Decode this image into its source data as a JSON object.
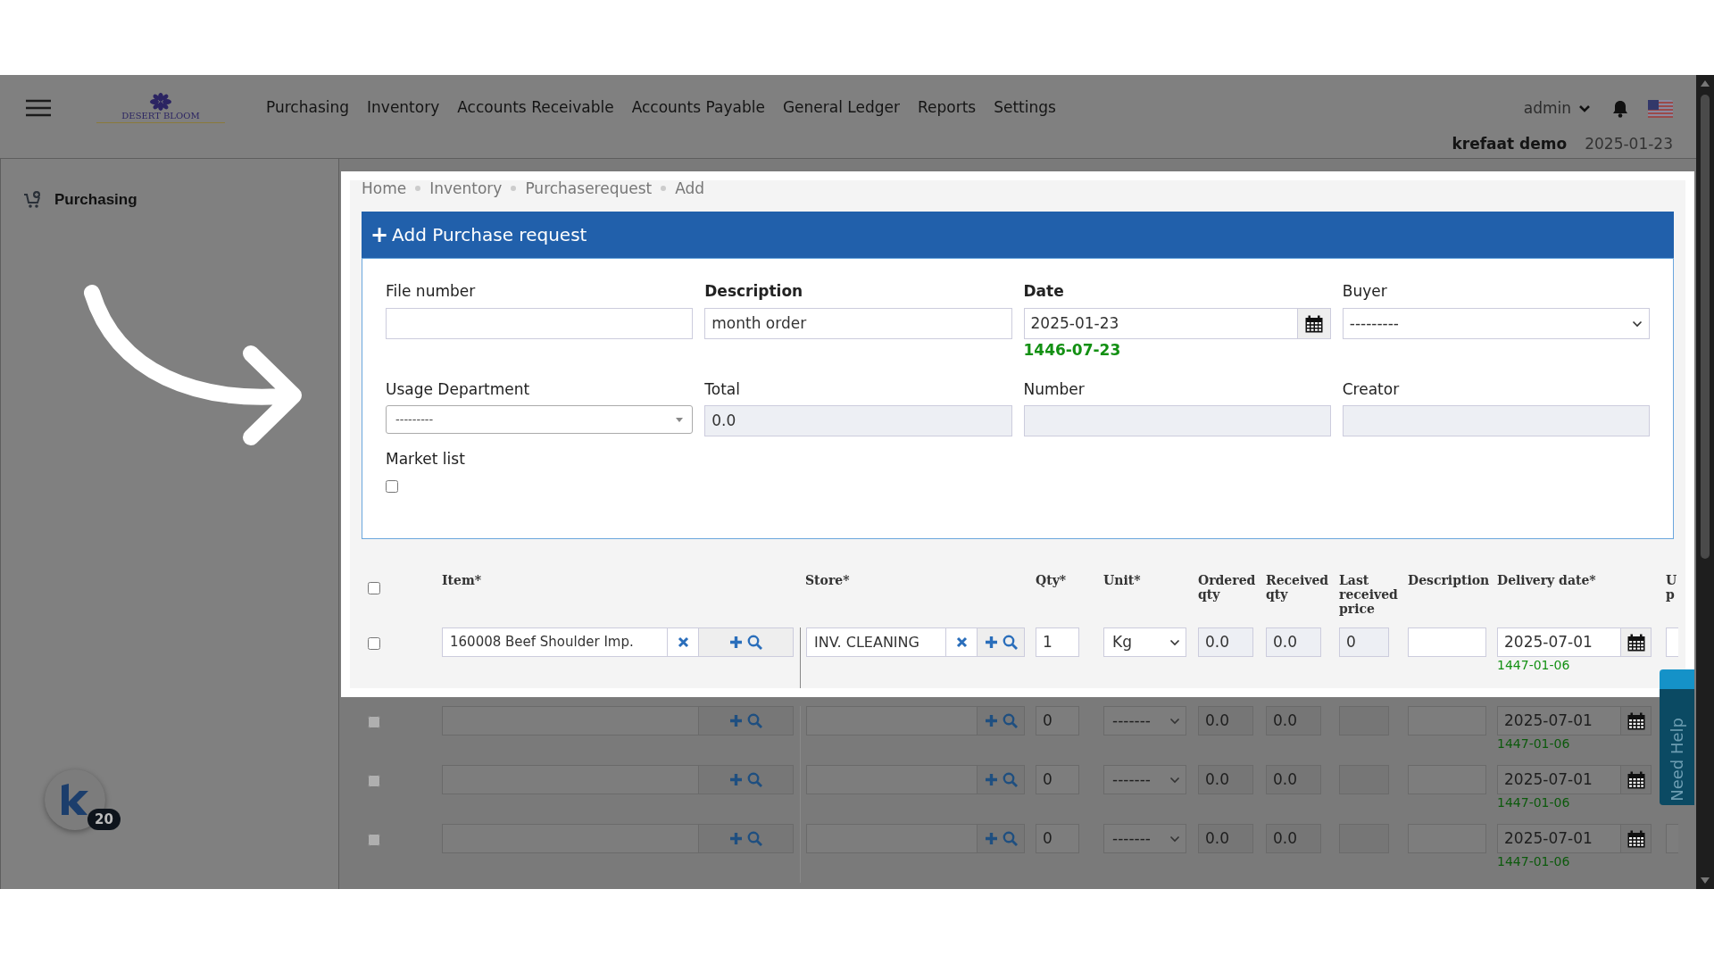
{
  "header": {
    "logo_text": "DESERT BLOOM",
    "nav": [
      "Purchasing",
      "Inventory",
      "Accounts Receivable",
      "Accounts Payable",
      "General Ledger",
      "Reports",
      "Settings"
    ],
    "user": "admin",
    "company": "krefaat demo",
    "date": "2025-01-23"
  },
  "sidebar": {
    "items": [
      {
        "label": "Purchasing"
      }
    ],
    "badge_count": "20"
  },
  "breadcrumb": [
    "Home",
    "Inventory",
    "Purchaserequest",
    "Add"
  ],
  "form": {
    "title": "Add Purchase request",
    "plus": "+",
    "fields": [
      {
        "label": "File number",
        "kind": "text",
        "required": false
      },
      {
        "label": "Description",
        "kind": "text",
        "required": true,
        "value": "month order"
      },
      {
        "label": "Date",
        "kind": "date",
        "required": true,
        "value": "2025-01-23",
        "hijri": "1446-07-23"
      },
      {
        "label": "Buyer",
        "kind": "select",
        "required": false,
        "value": "---------"
      },
      {
        "label": "Usage Department",
        "kind": "select2",
        "required": false,
        "value": "---------"
      },
      {
        "label": "Total",
        "kind": "readonly",
        "required": false,
        "value": "0.0"
      },
      {
        "label": "Number",
        "kind": "readonly",
        "required": false
      },
      {
        "label": "Creator",
        "kind": "readonly",
        "required": false
      },
      {
        "label": "Market list",
        "kind": "checkbox",
        "required": false,
        "checked": false
      }
    ]
  },
  "table": {
    "all_checked": false,
    "columns": [
      "Item*",
      "Store*",
      "Qty*",
      "Unit*",
      "Ordered qty",
      "Received qty",
      "Last received price",
      "Description",
      "Delivery date*",
      "U p"
    ],
    "rows": [
      {
        "checked": false,
        "spotlight": true,
        "item": "160008 Beef Shoulder Imp.",
        "store": "INV. CLEANING",
        "qty": "1",
        "unit": "Kg",
        "ordered_qty": "0.0",
        "received_qty": "0.0",
        "last_received_price": "0",
        "delivery_date": "2025-07-01",
        "hijri_date": "1447-01-06"
      },
      {
        "checked": false,
        "spotlight": false,
        "qty": "0",
        "unit": "-------",
        "ordered_qty": "0.0",
        "received_qty": "0.0",
        "delivery_date": "2025-07-01",
        "hijri_date": "1447-01-06"
      },
      {
        "checked": false,
        "spotlight": false,
        "qty": "0",
        "unit": "-------",
        "ordered_qty": "0.0",
        "received_qty": "0.0",
        "delivery_date": "2025-07-01",
        "hijri_date": "1447-01-06"
      },
      {
        "checked": false,
        "spotlight": false,
        "qty": "0",
        "unit": "-------",
        "ordered_qty": "0.0",
        "received_qty": "0.0",
        "delivery_date": "2025-07-01",
        "hijri_date": "1447-01-06"
      }
    ]
  },
  "help_tab": "Need Help"
}
